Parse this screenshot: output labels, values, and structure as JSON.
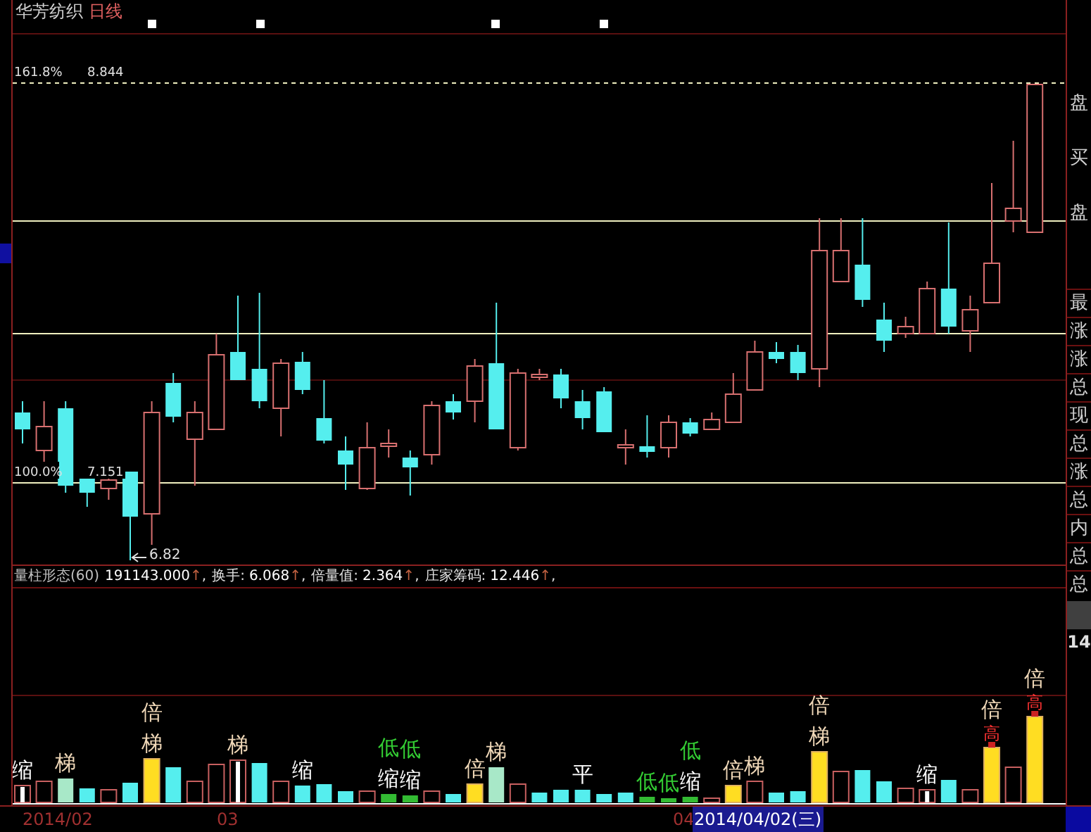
{
  "title": {
    "stock": "华芳纺织",
    "period": "日线"
  },
  "price_chart": {
    "levels": [
      {
        "kind": "dashed",
        "ratio": "161.8%",
        "price": "8.844"
      },
      {
        "kind": "solid",
        "ratio": "100.0%",
        "price": "7.151"
      }
    ],
    "low_mark": "6.82"
  },
  "indicator": {
    "name": "量柱形态(60)",
    "values": [
      {
        "value": "191143.000",
        "arrow": "↑",
        "separator": ","
      },
      {
        "label": "换手:",
        "value": "6.068",
        "arrow": "↑",
        "separator": ","
      },
      {
        "label": "倍量值:",
        "value": "2.364",
        "arrow": "↑",
        "separator": ","
      },
      {
        "label": "庄家筹码:",
        "value": "12.446",
        "arrow": "↑",
        "separator": ","
      }
    ]
  },
  "volume_bars": [
    {
      "kind": "shrink",
      "labels": [
        {
          "text": "缩",
          "color": "#ffffff"
        }
      ]
    },
    {
      "kind": "rise"
    },
    {
      "kind": "pale",
      "labels": [
        {
          "text": "梯",
          "color": "#f0d8b8"
        }
      ]
    },
    {
      "kind": "fall"
    },
    {
      "kind": "rise"
    },
    {
      "kind": "fall"
    },
    {
      "kind": "double",
      "labels": [
        {
          "text": "倍",
          "color": "#f0d8b8"
        },
        {
          "text": "梯",
          "color": "#f0d8b8"
        }
      ]
    },
    {
      "kind": "fall"
    },
    {
      "kind": "rise"
    },
    {
      "kind": "rise"
    },
    {
      "kind": "shrink",
      "labels": [
        {
          "text": "梯",
          "color": "#f0d8b8"
        }
      ]
    },
    {
      "kind": "fall"
    },
    {
      "kind": "rise"
    },
    {
      "kind": "fall",
      "labels": [
        {
          "text": "缩",
          "color": "#ffffff"
        }
      ]
    },
    {
      "kind": "fall"
    },
    {
      "kind": "fall"
    },
    {
      "kind": "rise"
    },
    {
      "kind": "low",
      "labels": [
        {
          "text": "低",
          "color": "#33cc33"
        },
        {
          "text": "缩",
          "color": "#ffffff"
        }
      ]
    },
    {
      "kind": "low",
      "labels": [
        {
          "text": "低",
          "color": "#33cc33"
        },
        {
          "text": "缩",
          "color": "#ffffff"
        }
      ]
    },
    {
      "kind": "rise"
    },
    {
      "kind": "fall"
    },
    {
      "kind": "double",
      "labels": [
        {
          "text": "倍",
          "color": "#f0d8b8"
        }
      ]
    },
    {
      "kind": "pale",
      "labels": [
        {
          "text": "梯",
          "color": "#f0d8b8"
        }
      ]
    },
    {
      "kind": "rise"
    },
    {
      "kind": "fall"
    },
    {
      "kind": "fall"
    },
    {
      "kind": "fall",
      "labels": [
        {
          "text": "平",
          "color": "#ffffff"
        }
      ]
    },
    {
      "kind": "fall"
    },
    {
      "kind": "fall"
    },
    {
      "kind": "low",
      "labels": [
        {
          "text": "低",
          "color": "#33cc33"
        }
      ]
    },
    {
      "kind": "low",
      "labels": [
        {
          "text": "低",
          "color": "#33cc33"
        }
      ]
    },
    {
      "kind": "low",
      "labels": [
        {
          "text": "低",
          "color": "#33cc33"
        },
        {
          "text": "缩",
          "color": "#ffffff"
        }
      ]
    },
    {
      "kind": "rise"
    },
    {
      "kind": "double",
      "labels": [
        {
          "text": "倍",
          "color": "#f0d8b8"
        }
      ]
    },
    {
      "kind": "rise",
      "labels": [
        {
          "text": "梯",
          "color": "#f0d8b8"
        }
      ]
    },
    {
      "kind": "fall"
    },
    {
      "kind": "fall"
    },
    {
      "kind": "double",
      "labels": [
        {
          "text": "倍",
          "color": "#f0d8b8"
        },
        {
          "text": "梯",
          "color": "#f0d8b8"
        }
      ]
    },
    {
      "kind": "rise"
    },
    {
      "kind": "fall"
    },
    {
      "kind": "fall"
    },
    {
      "kind": "rise"
    },
    {
      "kind": "shrink",
      "labels": [
        {
          "text": "缩",
          "color": "#ffffff"
        }
      ]
    },
    {
      "kind": "fall"
    },
    {
      "kind": "rise"
    },
    {
      "kind": "peak",
      "labels": [
        {
          "text": "倍",
          "color": "#f0d8b8"
        },
        {
          "text": "高",
          "color": "#ff3333"
        }
      ]
    },
    {
      "kind": "rise"
    },
    {
      "kind": "peak",
      "labels": [
        {
          "text": "倍",
          "color": "#f0d8b8"
        },
        {
          "text": "高",
          "color": "#ff3333"
        }
      ]
    }
  ],
  "date_axis": {
    "months": [
      {
        "text": "2014/02",
        "selected": false
      },
      {
        "text": "03",
        "selected": false
      },
      {
        "text": "04",
        "selected": false
      }
    ],
    "cursor_date": "2014/04/02(三)"
  },
  "right_panel": {
    "top": [
      "盘",
      "买",
      "盘"
    ],
    "list": [
      "最",
      "涨",
      "涨",
      "总",
      "现",
      "总",
      "涨",
      "总",
      "内",
      "总",
      "总"
    ],
    "value": "14"
  }
}
